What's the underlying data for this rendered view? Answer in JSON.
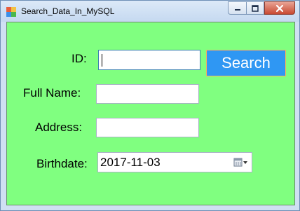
{
  "window": {
    "title": "Search_Data_In_MySQL",
    "controls": {
      "minimize": "minimize",
      "maximize": "maximize",
      "close": "close"
    }
  },
  "form": {
    "background_color": "#80ff80",
    "id": {
      "label": "ID:",
      "value": ""
    },
    "full_name": {
      "label": "Full Name:",
      "value": ""
    },
    "address": {
      "label": "Address:",
      "value": ""
    },
    "birthdate": {
      "label": "Birthdate:",
      "value": "2017-11-03",
      "icon": "calendar-dropdown-icon"
    },
    "search_button": {
      "label": "Search",
      "color": "#2f97f3",
      "border_color": "#ffb25a"
    }
  }
}
